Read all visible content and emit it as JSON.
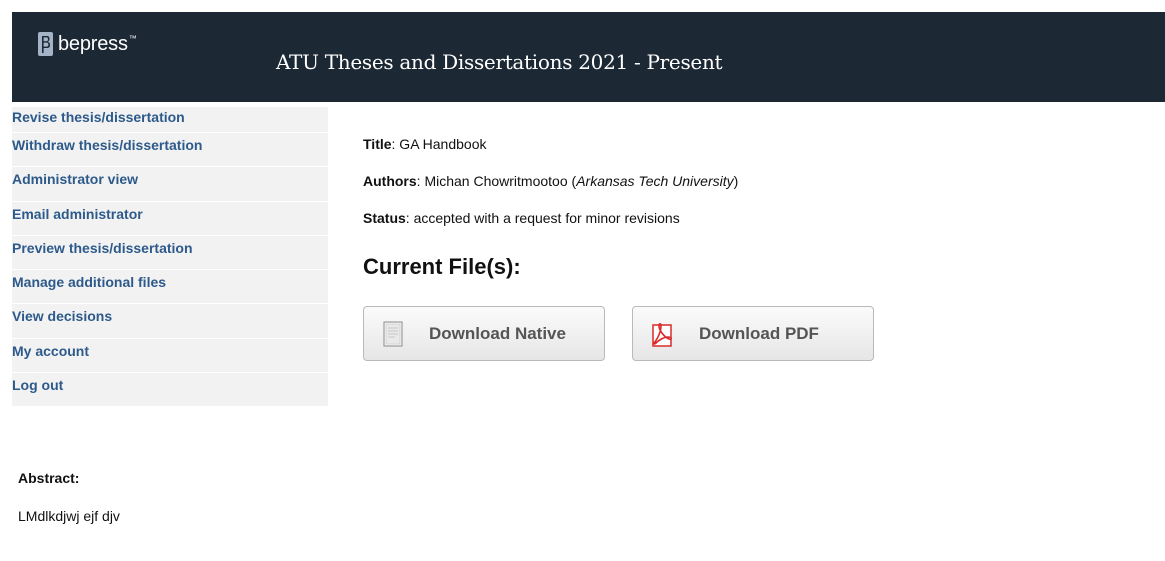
{
  "header": {
    "logo_text": "bepress",
    "logo_tm": "™",
    "site_title": "ATU Theses and Dissertations 2021 - Present",
    "background": "#1c2834"
  },
  "sidebar": {
    "items": [
      {
        "label": "Revise thesis/dissertation"
      },
      {
        "label": "Withdraw thesis/dissertation"
      },
      {
        "label": "Administrator view"
      },
      {
        "label": "Email administrator"
      },
      {
        "label": "Preview thesis/dissertation"
      },
      {
        "label": "Manage additional files"
      },
      {
        "label": "View decisions"
      },
      {
        "label": "My account"
      },
      {
        "label": "Log out"
      }
    ],
    "link_color": "#2d5a8a"
  },
  "meta": {
    "title_label": "Title",
    "title_value": ": GA Handbook",
    "authors_label": "Authors",
    "authors_value": ": Michan Chowritmootoo (",
    "authors_affiliation": "Arkansas Tech University",
    "authors_close": ")",
    "status_label": "Status",
    "status_value": ": accepted with a request for minor revisions"
  },
  "files": {
    "heading": "Current File(s):",
    "buttons": [
      {
        "label": "Download Native",
        "icon": "document-icon"
      },
      {
        "label": "Download PDF",
        "icon": "pdf-icon"
      }
    ]
  },
  "abstract": {
    "label": "Abstract:",
    "text": "LMdlkdjwj ejf djv"
  }
}
